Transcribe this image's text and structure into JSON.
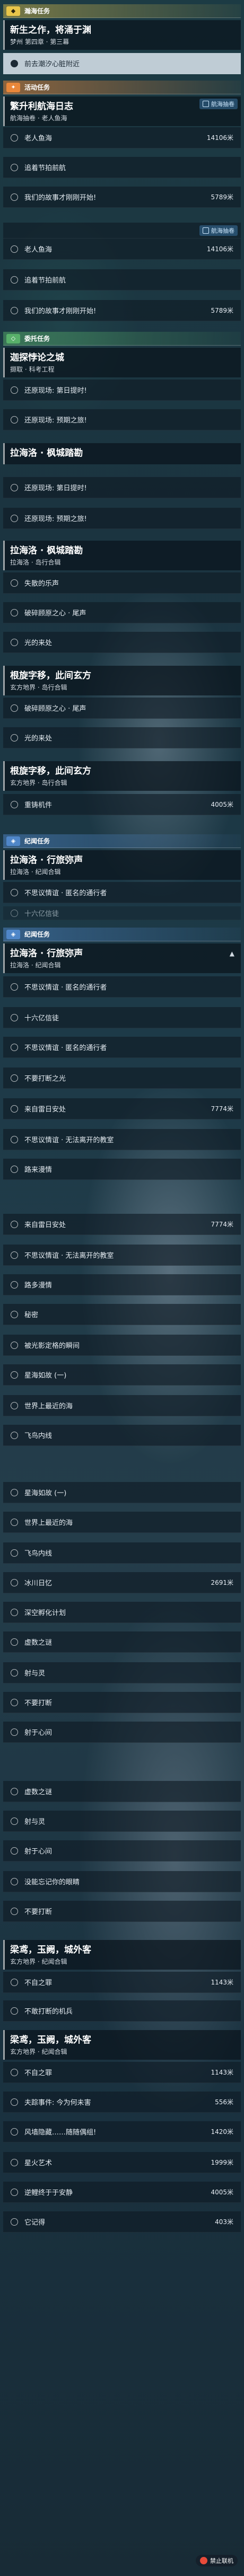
{
  "categories": {
    "yellow": {
      "label": "瀚海任务"
    },
    "orange": {
      "label": "活动任务"
    },
    "green": {
      "label": "委托任务"
    },
    "blue": {
      "label": "纪闻任务"
    }
  },
  "quest_headers": [
    {
      "title": "新生之作，将涌于渊",
      "subtitle": "梦州 第四章 · 第三幕"
    },
    {
      "title": "繁升利航海日志",
      "subtitle": "航海抽卷 · 老人鱼海",
      "track": "航海抽卷"
    },
    {
      "title": "迦探悖论之城",
      "subtitle": "撷取 · 科考工程"
    },
    {
      "title": "拉海洛 · 枫城踏勘",
      "subtitle": ""
    },
    {
      "title": "拉海洛 · 枫城踏勘",
      "subtitle": "拉海洛 · 岛行合辑"
    },
    {
      "title": "根旋字移，此间玄方",
      "subtitle": "玄方地界 · 岛行合辑"
    },
    {
      "title": "根旋字移，此间玄方",
      "subtitle": "玄方地界 · 岛行合辑"
    },
    {
      "title": "拉海洛 · 行旅弥声",
      "subtitle": "拉海洛 · 纪闻合辑"
    },
    {
      "title": "拉海洛 · 行旅弥声",
      "subtitle": "拉海洛 · 纪闻合辑"
    },
    {
      "title": "梁鸢，玉阙，城外客",
      "subtitle": "玄方地界 · 纪闻合辑"
    },
    {
      "title": "梁鸢，玉阙，城外客",
      "subtitle": "玄方地界 · 纪闻合辑"
    }
  ],
  "rows": [
    {
      "label": "前去潮汐心脏附近",
      "dist": "",
      "sel": true
    },
    {
      "label": "老人鱼海",
      "dist": "14106米"
    },
    {
      "label": "追着节拍前航",
      "dist": ""
    },
    {
      "label": "我们的故事才刚刚开始!",
      "dist": "5789米"
    },
    {
      "label": "老人鱼海",
      "dist": "14106米"
    },
    {
      "label": "追着节拍前航",
      "dist": ""
    },
    {
      "label": "我们的故事才刚刚开始!",
      "dist": "5789米"
    },
    {
      "label": "还原现场: 第日提时!",
      "dist": ""
    },
    {
      "label": "还原现场: 预期之旅!",
      "dist": ""
    },
    {
      "label": "还原现场: 第日提时!",
      "dist": ""
    },
    {
      "label": "还原现场: 预期之旅!",
      "dist": ""
    },
    {
      "label": "失散的乐声",
      "dist": ""
    },
    {
      "label": "破碎顾原之心 · 尾声",
      "dist": ""
    },
    {
      "label": "光的来处",
      "dist": ""
    },
    {
      "label": "破碎顾原之心 · 尾声",
      "dist": ""
    },
    {
      "label": "光的来处",
      "dist": ""
    },
    {
      "label": "重铸机件",
      "dist": "4005米"
    },
    {
      "label": "不思议情谊 · 匿名的通行者",
      "dist": ""
    },
    {
      "label": "十六亿信徒",
      "dist": "",
      "dim": true
    },
    {
      "label": "不思议情谊 · 匿名的通行者",
      "dist": ""
    },
    {
      "label": "十六亿信徒",
      "dist": ""
    },
    {
      "label": "不思议情谊 · 匿名的通行者",
      "dist": ""
    },
    {
      "label": "不要打断之光",
      "dist": ""
    },
    {
      "label": "来自雷日安处",
      "dist": "7774米"
    },
    {
      "label": "不思议情谊 · 无法离开的教室",
      "dist": ""
    },
    {
      "label": "路来漫情",
      "dist": ""
    },
    {
      "label": "来自雷日安处",
      "dist": "7774米"
    },
    {
      "label": "不思议情谊 · 无法离开的教室",
      "dist": ""
    },
    {
      "label": "路多漫情",
      "dist": ""
    },
    {
      "label": "秘密",
      "dist": ""
    },
    {
      "label": "被光影定格的瞬间",
      "dist": ""
    },
    {
      "label": "星海如故 (一)",
      "dist": ""
    },
    {
      "label": "世界上最近的海",
      "dist": ""
    },
    {
      "label": "飞鸟内线",
      "dist": ""
    },
    {
      "label": "星海如故 (一)",
      "dist": ""
    },
    {
      "label": "世界上最近的海",
      "dist": ""
    },
    {
      "label": "飞鸟内线",
      "dist": ""
    },
    {
      "label": "冰川日忆",
      "dist": "2691米"
    },
    {
      "label": "深空孵化计划",
      "dist": ""
    },
    {
      "label": "虚数之谜",
      "dist": ""
    },
    {
      "label": "射与灵",
      "dist": ""
    },
    {
      "label": "不要打断",
      "dist": ""
    },
    {
      "label": "射于心间",
      "dist": ""
    },
    {
      "label": "虚数之谜",
      "dist": ""
    },
    {
      "label": "射与灵",
      "dist": ""
    },
    {
      "label": "射于心间",
      "dist": ""
    },
    {
      "label": "没能忘记你的眼睛",
      "dist": ""
    },
    {
      "label": "不要打断",
      "dist": ""
    },
    {
      "label": "不自之罪",
      "dist": "1143米"
    },
    {
      "label": "不敢打断的机兵",
      "dist": ""
    },
    {
      "label": "不自之罪",
      "dist": "1143米"
    },
    {
      "label": "夫踪事件: 今为何未害",
      "dist": "556米"
    },
    {
      "label": "风墙隐藏……随随偶组!",
      "dist": "1420米"
    },
    {
      "label": "星火艺术",
      "dist": "1999米"
    },
    {
      "label": "逆鲤终于于安静",
      "dist": "4005米"
    },
    {
      "label": "它记得",
      "dist": "403米"
    }
  ],
  "badge": {
    "label": "禁止联机"
  },
  "collapse_icon": "chevron-up-icon",
  "track_icon": "pin-icon"
}
